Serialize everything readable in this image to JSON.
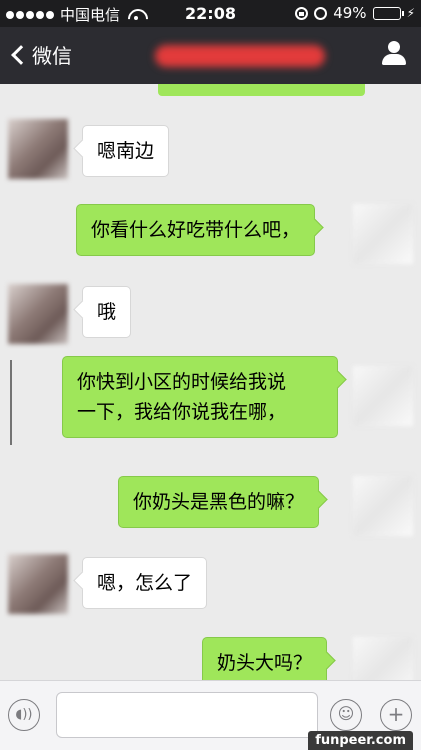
{
  "status_bar": {
    "carrier": "中国电信",
    "time": "22:08",
    "battery": "49%",
    "battery_level": 0.49
  },
  "nav": {
    "back_label": "微信",
    "title_obscured": true
  },
  "messages": [
    {
      "side": "in",
      "text": "嗯南边"
    },
    {
      "side": "out",
      "text": "你看什么好吃带什么吧，"
    },
    {
      "side": "in",
      "text": "哦"
    },
    {
      "side": "out",
      "lines": [
        "你快到小区的时候给我说",
        "一下，我给你说我在哪，"
      ]
    },
    {
      "side": "out",
      "text": "你奶头是黑色的嘛？"
    },
    {
      "side": "in",
      "text": "嗯，怎么了"
    },
    {
      "side": "out",
      "text": "奶头大吗？"
    }
  ],
  "input_bar": {
    "placeholder": "",
    "icons": [
      "voice-icon",
      "emoji-icon",
      "plus-icon"
    ]
  },
  "watermark": "funpeer.com"
}
